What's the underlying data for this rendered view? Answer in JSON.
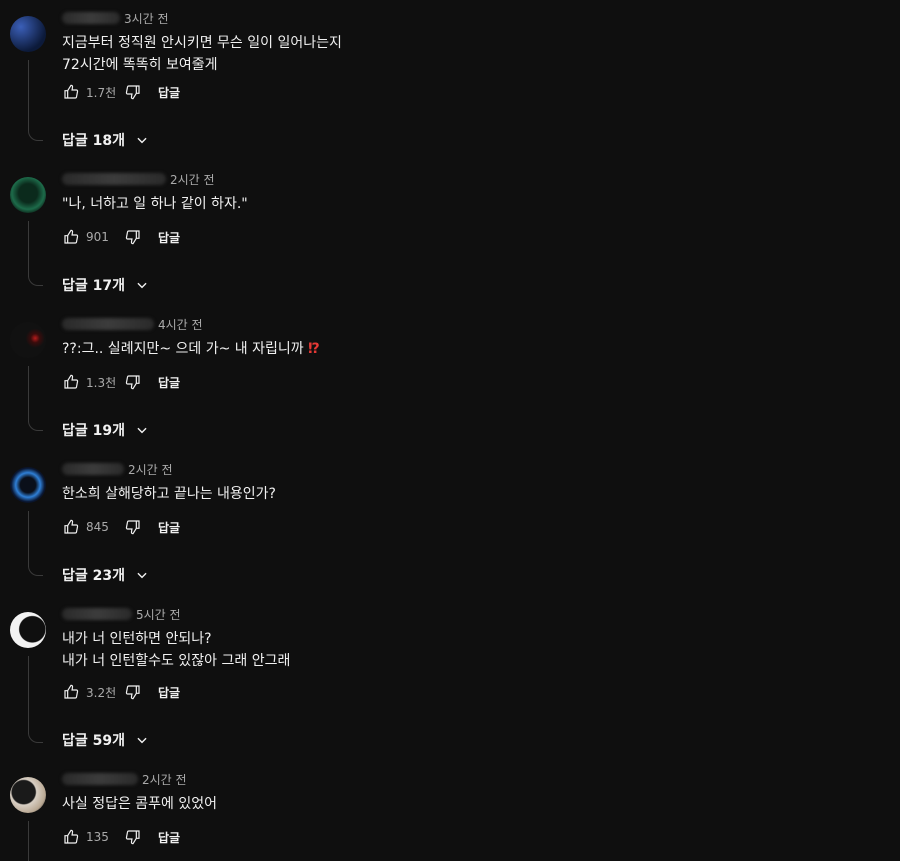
{
  "comments": [
    {
      "time": "3시간 전",
      "lines": "지금부터 정직원 안시키면 무슨 일이 일어나는지\n72시간에 똑똑히 보여줄게",
      "likes": "1.7천",
      "reply_label": "답글",
      "replies_label": "답글 18개",
      "avatar_color": "#1e3a8a"
    },
    {
      "time": "2시간 전",
      "lines": "\"나, 너하고 일 하나 같이 하자.\"",
      "likes": "901",
      "reply_label": "답글",
      "replies_label": "답글 17개",
      "avatar_color": "#0f3d2a"
    },
    {
      "time": "4시간 전",
      "lines": "??:그.. 실례지만~ 으데 가~ 내 자립니까 ",
      "emoji": "⁉",
      "likes": "1.3천",
      "reply_label": "답글",
      "replies_label": "답글 19개",
      "avatar_color": "#1a1a1a"
    },
    {
      "time": "2시간 전",
      "lines": "한소희 살해당하고 끝나는 내용인가?",
      "likes": "845",
      "reply_label": "답글",
      "replies_label": "답글 23개",
      "avatar_color": "#0b1f3a"
    },
    {
      "time": "5시간 전",
      "lines": "내가 너 인턴하면 안되나?\n내가 너 인턴할수도 있잖아 그래 안그래",
      "likes": "3.2천",
      "reply_label": "답글",
      "replies_label": "답글 59개",
      "avatar_color": "#f0f0f0"
    },
    {
      "time": "2시간 전",
      "lines": "사실 정답은 콤푸에 있었어",
      "likes": "135",
      "reply_label": "답글",
      "avatar_color": "#d8cfc4"
    }
  ],
  "icons": {
    "like": "thumbs-up-icon",
    "dislike": "thumbs-down-icon",
    "expand": "chevron-down-icon"
  }
}
